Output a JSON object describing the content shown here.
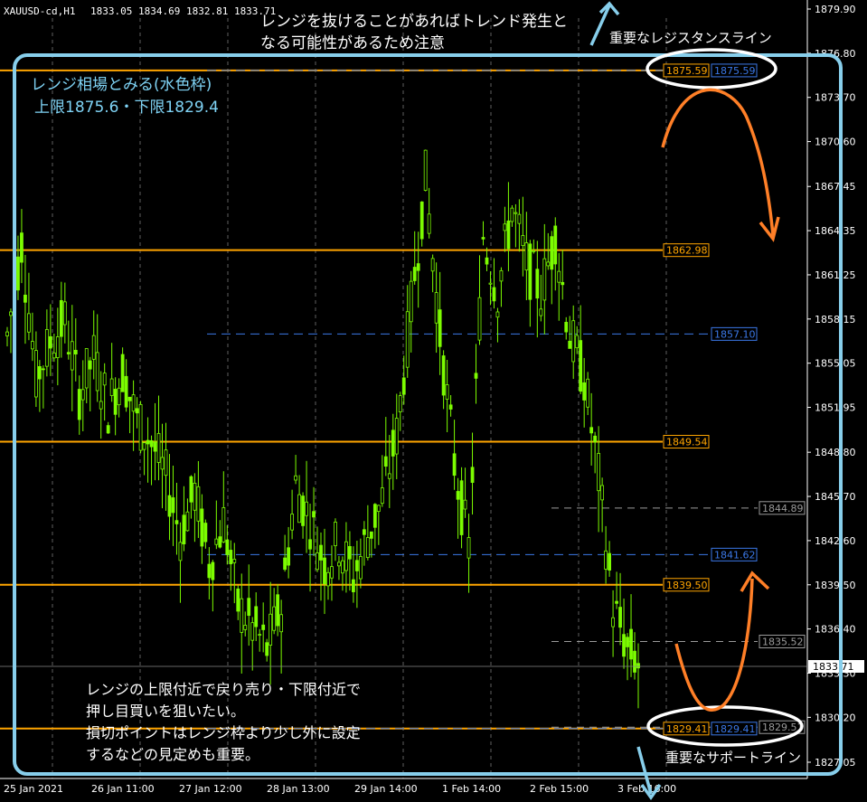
{
  "header": {
    "symbol": "XAUUSD-cd,H1",
    "ohlc": "1833.05 1834.69 1832.81 1833.71"
  },
  "colors": {
    "background": "#000000",
    "candle": "#7CFC00",
    "resistance_line": "#ffa500",
    "blue_line": "#3b78e7",
    "grey_line": "#9a9a9a",
    "range_box": "#87ceeb",
    "arrow": "#ff7f27",
    "axis_text": "#ffffff"
  },
  "annotations": {
    "breakout_note_line1": "レンジを抜けることがあればトレンド発生と",
    "breakout_note_line2": "なる可能性があるため注意",
    "range_title": "レンジ相場とみる(水色枠)",
    "range_values": "上限1875.6・下限1829.4",
    "resistance_caption": "重要なレジスタンスライン",
    "support_caption": "重要なサポートライン",
    "strategy_line1": "レンジの上限付近で戻り売り・下限付近で",
    "strategy_line2": "押し目買いを狙いたい。",
    "strategy_line3": "損切ポイントはレンジ枠より少し外に設定",
    "strategy_line4": "するなどの見定めも重要。"
  },
  "chart_data": {
    "type": "line",
    "title": "",
    "xlabel": "",
    "ylabel": "",
    "ylim": [
      1827.05,
      1879.9
    ],
    "y_ticks": [
      "1879.90",
      "1876.80",
      "1873.70",
      "1870.60",
      "1867.45",
      "1864.35",
      "1861.25",
      "1858.15",
      "1855.05",
      "1851.95",
      "1848.80",
      "1845.70",
      "1842.60",
      "1839.50",
      "1836.40",
      "1833.30",
      "1830.20",
      "1827.05"
    ],
    "x_ticks": [
      "25 Jan 2021",
      "26 Jan 11:00",
      "27 Jan 12:00",
      "28 Jan 13:00",
      "29 Jan 14:00",
      "1 Feb 14:00",
      "2 Feb 15:00",
      "3 Feb 16:00"
    ],
    "current_price": "1833.71",
    "levels": [
      {
        "value": 1875.59,
        "label": "1875.59",
        "kind": "orange"
      },
      {
        "value": 1875.59,
        "label": "1875.59",
        "kind": "blue"
      },
      {
        "value": 1862.98,
        "label": "1862.98",
        "kind": "orange"
      },
      {
        "value": 1857.1,
        "label": "1857.10",
        "kind": "blue"
      },
      {
        "value": 1849.54,
        "label": "1849.54",
        "kind": "orange"
      },
      {
        "value": 1844.89,
        "label": "1844.89",
        "kind": "grey"
      },
      {
        "value": 1841.62,
        "label": "1841.62",
        "kind": "blue"
      },
      {
        "value": 1839.5,
        "label": "1839.50",
        "kind": "orange"
      },
      {
        "value": 1835.52,
        "label": "1835.52",
        "kind": "grey"
      },
      {
        "value": 1829.41,
        "label": "1829.41",
        "kind": "orange"
      },
      {
        "value": 1829.41,
        "label": "1829.41",
        "kind": "blue"
      },
      {
        "value": 1829.51,
        "label": "1829.51",
        "kind": "grey"
      }
    ],
    "series": [
      {
        "x": [
          0,
          4,
          8,
          12,
          16,
          20,
          24,
          28,
          32,
          36,
          40,
          44,
          48,
          52,
          56,
          60,
          64,
          68,
          72,
          76,
          80,
          84,
          88,
          92,
          96,
          100,
          104,
          108,
          112,
          116,
          120,
          124,
          128,
          132,
          136,
          140,
          144,
          148,
          152,
          156,
          160,
          164,
          168,
          172,
          176
        ],
        "values": [
          1857.0,
          1863.5,
          1854.0,
          1856.5,
          1858.0,
          1853.0,
          1855.5,
          1852.0,
          1854.5,
          1851.0,
          1849.5,
          1847.0,
          1843.0,
          1846.0,
          1841.0,
          1844.0,
          1838.0,
          1836.5,
          1835.0,
          1838.0,
          1846.5,
          1844.0,
          1841.0,
          1842.5,
          1840.0,
          1843.0,
          1845.5,
          1850.0,
          1859.0,
          1868.0,
          1857.0,
          1848.0,
          1842.0,
          1864.0,
          1860.0,
          1866.0,
          1862.0,
          1860.0,
          1864.0,
          1857.0,
          1854.0,
          1847.0,
          1838.0,
          1835.0,
          1833.7
        ]
      }
    ]
  }
}
